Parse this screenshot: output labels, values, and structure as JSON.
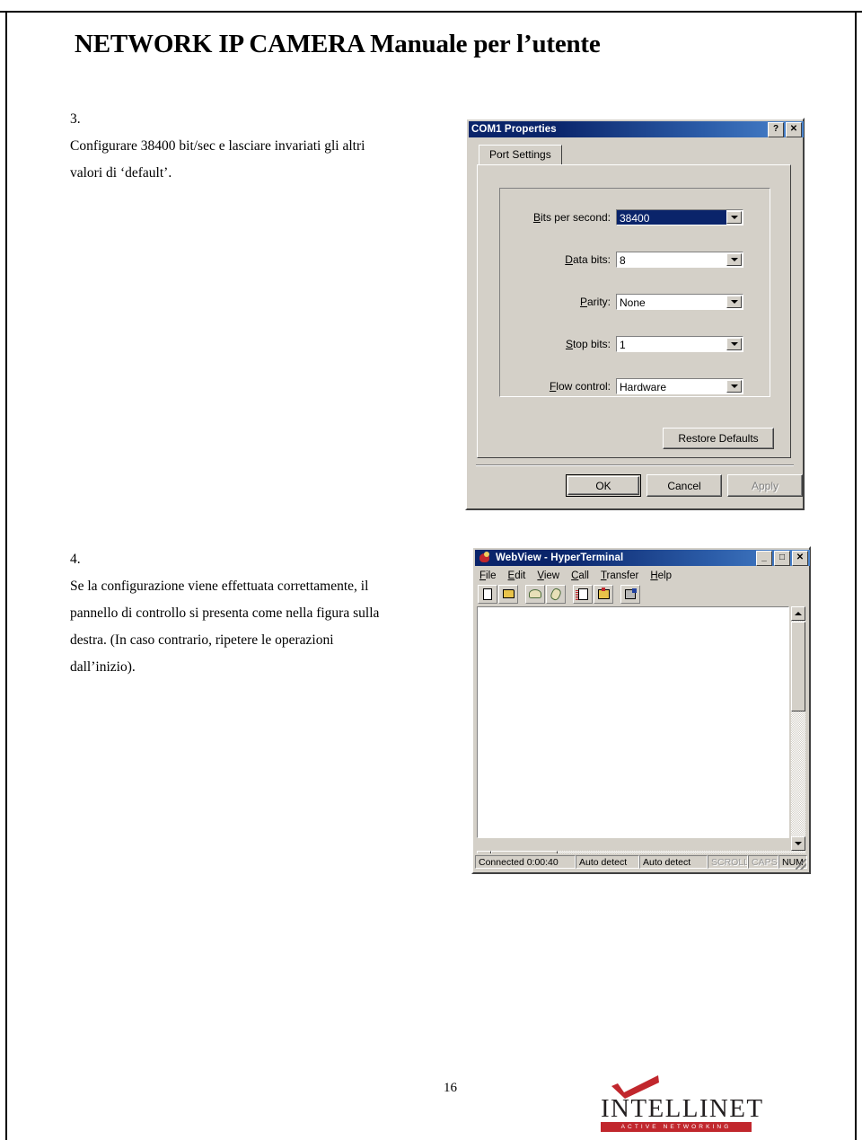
{
  "document": {
    "title": "NETWORK IP CAMERA Manuale per l’utente",
    "page_number": "16"
  },
  "steps": [
    {
      "number": "3.",
      "lines": [
        [
          "Configurare",
          "38400",
          "bit/sec",
          "e",
          "lasciare",
          "invariati",
          "gli",
          "altri"
        ],
        [
          "valori di ‘default’."
        ]
      ]
    },
    {
      "number": "4.",
      "lines": [
        [
          "Se",
          "la",
          "configurazione",
          "viene",
          "effettuata",
          "correttamente,",
          "il"
        ],
        [
          "pannello",
          "di",
          "controllo",
          "si",
          "presenta",
          "come",
          "nella",
          "figura",
          "sulla"
        ],
        [
          "destra.",
          "(In",
          "caso",
          "contrario,",
          "ripetere",
          "le",
          "operazioni"
        ],
        [
          "dall’inizio)."
        ]
      ]
    }
  ],
  "com1_dialog": {
    "title": "COM1 Properties",
    "help_button": "?",
    "close_button": "✕",
    "tab": "Port Settings",
    "fields": [
      {
        "label_pre": "B",
        "label_rest": "its per second:",
        "value": "38400",
        "selected": true
      },
      {
        "label_pre": "D",
        "label_rest": "ata bits:",
        "value": "8",
        "selected": false
      },
      {
        "label_pre": "P",
        "label_rest": "arity:",
        "value": "None",
        "selected": false
      },
      {
        "label_pre": "S",
        "label_rest": "top bits:",
        "value": "1",
        "selected": false
      },
      {
        "label_pre": "F",
        "label_rest": "low control:",
        "value": "Hardware",
        "selected": false
      }
    ],
    "restore_defaults": "Restore Defaults",
    "ok": "OK",
    "cancel": "Cancel",
    "apply": "Apply"
  },
  "hyperterminal": {
    "title": "WebView - HyperTerminal",
    "minimize_button": "_",
    "maximize_button": "□",
    "close_button": "✕",
    "menu": [
      {
        "pre": "F",
        "rest": "ile"
      },
      {
        "pre": "E",
        "rest": "dit"
      },
      {
        "pre": "V",
        "rest": "iew"
      },
      {
        "pre": "C",
        "rest": "all"
      },
      {
        "pre": "T",
        "rest": "ransfer"
      },
      {
        "pre": "H",
        "rest": "elp"
      }
    ],
    "toolbar_icons": [
      "new-connection-icon",
      "open-connection-icon",
      "call-icon",
      "disconnect-icon",
      "send-file-icon",
      "receive-file-icon",
      "properties-icon"
    ],
    "terminal_text": "",
    "statusbar": [
      {
        "text": "Connected 0:00:40",
        "dim": false
      },
      {
        "text": "Auto detect",
        "dim": false
      },
      {
        "text": "Auto detect",
        "dim": false
      },
      {
        "text": "SCROLL",
        "dim": true
      },
      {
        "text": "CAPS",
        "dim": true
      },
      {
        "text": "NUM",
        "dim": false
      }
    ]
  },
  "logo": {
    "wordmark": "INTELLINET",
    "tagline": "ACTIVE NETWORKING",
    "accent_color": "#c1272d"
  },
  "colors": {
    "titlebar_start": "#0a246a",
    "titlebar_end": "#4a84cd",
    "window_face": "#d4d0c8",
    "selection": "#0a246a",
    "brand_red": "#c1272d"
  }
}
